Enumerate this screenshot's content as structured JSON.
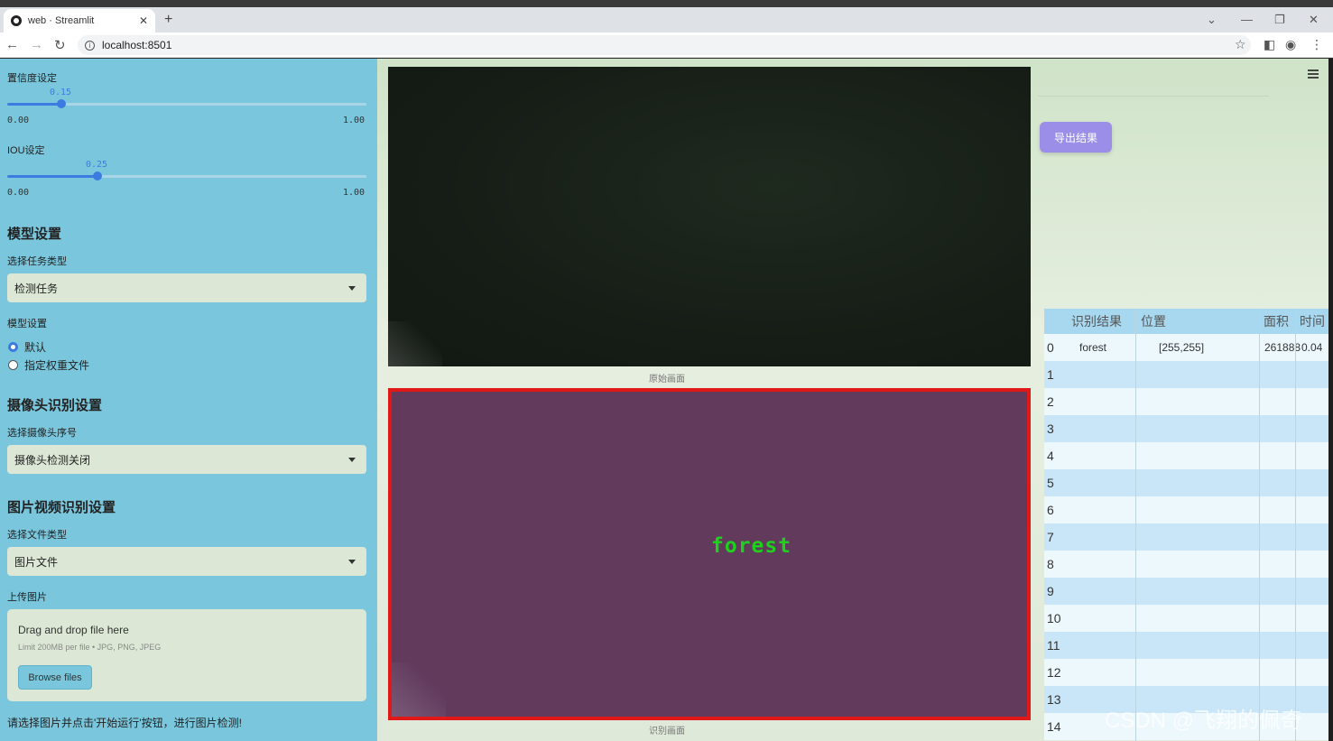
{
  "browser": {
    "tab_title": "web · Streamlit",
    "tab_close": "✕",
    "new_tab": "+",
    "url": "localhost:8501"
  },
  "sidebar": {
    "confidence": {
      "label": "置信度设定",
      "value": 0.15,
      "value_text": "0.15",
      "min": "0.00",
      "max": "1.00"
    },
    "iou": {
      "label": "IOU设定",
      "value": 0.25,
      "value_text": "0.25",
      "min": "0.00",
      "max": "1.00"
    },
    "model_settings": {
      "heading": "模型设置",
      "task_label": "选择任务类型",
      "task_value": "检测任务",
      "model_label": "模型设置",
      "options": [
        "默认",
        "指定权重文件"
      ],
      "selected": 0
    },
    "camera": {
      "heading": "摄像头识别设置",
      "label": "选择摄像头序号",
      "value": "摄像头检测关闭"
    },
    "media": {
      "heading": "图片视频识别设置",
      "file_type_label": "选择文件类型",
      "file_type_value": "图片文件",
      "upload_label": "上传图片",
      "drop_text": "Drag and drop file here",
      "limit_text": "Limit 200MB per file • JPG, PNG, JPEG",
      "browse_label": "Browse files"
    },
    "note": "请选择图片并点击'开始运行'按钮，进行图片检测!"
  },
  "main": {
    "original_caption": "原始画面",
    "result_caption": "识别画面",
    "detection_label": "forest",
    "export_label": "导出结果"
  },
  "table": {
    "headers": [
      "识别结果",
      "位置",
      "面积",
      "时间"
    ],
    "rows": [
      {
        "index": "0",
        "result": "forest",
        "position": "[255,255]",
        "area": "261888",
        "time": "0.04"
      },
      {
        "index": "1"
      },
      {
        "index": "2"
      },
      {
        "index": "3"
      },
      {
        "index": "4"
      },
      {
        "index": "5"
      },
      {
        "index": "6"
      },
      {
        "index": "7"
      },
      {
        "index": "8"
      },
      {
        "index": "9"
      },
      {
        "index": "10"
      },
      {
        "index": "11"
      },
      {
        "index": "12"
      },
      {
        "index": "13"
      },
      {
        "index": "14"
      }
    ]
  },
  "watermark": "CSDN @飞翔的佩奇",
  "colors": {
    "sidebar_bg": "#7ac7dd",
    "accent": "#3d7be0",
    "export_button": "#9b8ee8",
    "detection_border": "#e01818",
    "detection_text": "#1fd01f"
  }
}
